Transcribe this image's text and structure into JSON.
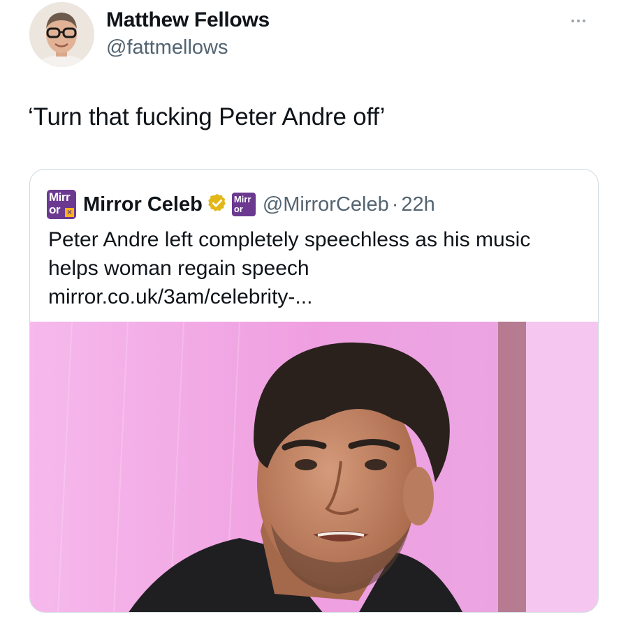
{
  "author": {
    "name": "Matthew Fellows",
    "handle": "@fattmellows",
    "avatar_icon": "profile-photo"
  },
  "tweet": {
    "text": "‘Turn that fucking Peter Andre off’"
  },
  "quoted": {
    "logo_text": [
      "Mirr",
      "or"
    ],
    "name": "Mirror Celeb",
    "handle": "@MirrorCeleb",
    "separator": "·",
    "time": "22h",
    "text": "Peter Andre left completely speechless as his music helps woman regain speech",
    "link": "mirror.co.uk/3am/celebrity-...",
    "verified_color": "#e2b719",
    "brand_color": "#6b3a90"
  },
  "colors": {
    "text": "#0f1419",
    "secondary": "#536471",
    "border": "#cfd9de",
    "media_bg": "#f2a8e6"
  }
}
